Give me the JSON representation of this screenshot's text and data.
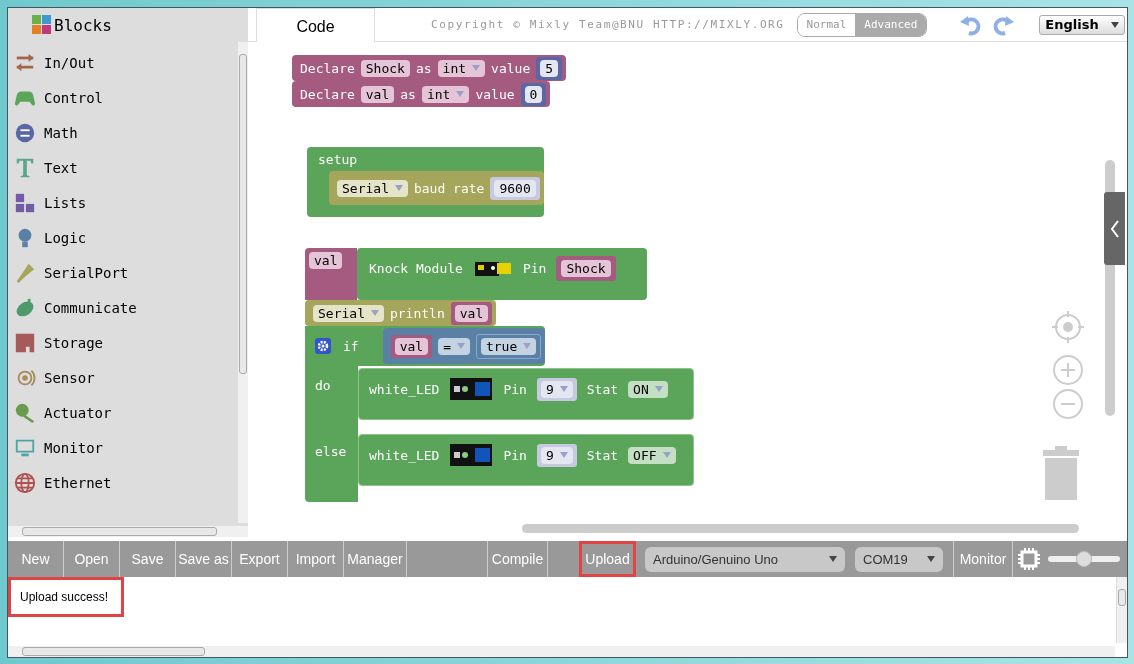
{
  "header": {
    "title": "Blocks"
  },
  "tabs": [
    {
      "label": "Code",
      "selected": true
    }
  ],
  "copyright": "Copyright © Mixly Team@BNU HTTP://MIXLY.ORG",
  "mode_toggle": [
    {
      "label": "Normal",
      "selected": false
    },
    {
      "label": "Advanced",
      "selected": true
    }
  ],
  "language": "English",
  "categories": [
    {
      "label": "In/Out",
      "kind": "arrows",
      "color": "#a0674a"
    },
    {
      "label": "Control",
      "kind": "gamepad",
      "color": "#5ba55b"
    },
    {
      "label": "Math",
      "kind": "math",
      "color": "#5b67a5"
    },
    {
      "label": "Text",
      "kind": "text",
      "color": "#5ba58c"
    },
    {
      "label": "Lists",
      "kind": "lists",
      "color": "#745ba5"
    },
    {
      "label": "Logic",
      "kind": "logic",
      "color": "#5b80a5"
    },
    {
      "label": "SerialPort",
      "kind": "serial",
      "color": "#a5a55b"
    },
    {
      "label": "Communicate",
      "kind": "communicate",
      "color": "#4e9a6a"
    },
    {
      "label": "Storage",
      "kind": "storage",
      "color": "#a55b5b"
    },
    {
      "label": "Sensor",
      "kind": "sensor",
      "color": "#a58c5b"
    },
    {
      "label": "Actuator",
      "kind": "actuator",
      "color": "#6a9a4e"
    },
    {
      "label": "Monitor",
      "kind": "monitor",
      "color": "#4ea5a5"
    },
    {
      "label": "Ethernet",
      "kind": "ethernet",
      "color": "#b05050"
    }
  ],
  "workspace": {
    "declarations": [
      {
        "keyword": "Declare",
        "name": "Shock",
        "as": "as",
        "type": "int",
        "value_label": "value",
        "value": "5"
      },
      {
        "keyword": "Declare",
        "name": "val",
        "as": "as",
        "type": "int",
        "value_label": "value",
        "value": "0"
      }
    ],
    "setup": {
      "label": "setup",
      "serial": "Serial",
      "text": "baud rate",
      "value": "9600"
    },
    "assign": {
      "variable": "val",
      "module": "Knock Module",
      "pin_label": "Pin",
      "pin": "Shock"
    },
    "print": {
      "serial": "Serial",
      "text": "println",
      "value": "val"
    },
    "condition": {
      "label": "if",
      "left": "val",
      "operator": "=",
      "right": "true",
      "do_label": "do",
      "else_label": "else"
    },
    "actions": [
      {
        "name": "white_LED",
        "pin_label": "Pin",
        "pin": "9",
        "stat_label": "Stat",
        "state": "ON"
      },
      {
        "name": "white_LED",
        "pin_label": "Pin",
        "pin": "9",
        "stat_label": "Stat",
        "state": "OFF"
      }
    ]
  },
  "toolbar": {
    "buttons": [
      {
        "label": "New"
      },
      {
        "label": "Open"
      },
      {
        "label": "Save"
      },
      {
        "label": "Save as"
      },
      {
        "label": "Export"
      },
      {
        "label": "Import"
      },
      {
        "label": "Manager"
      }
    ],
    "actions": [
      {
        "label": "Compile",
        "highlighted": false
      },
      {
        "label": "Upload",
        "highlighted": true
      }
    ],
    "board": "Arduino/Genuino Uno",
    "port": "COM19",
    "monitor": "Monitor",
    "speed": {
      "level": 0.5
    }
  },
  "output": {
    "message": "Upload success!",
    "highlighted": true
  }
}
